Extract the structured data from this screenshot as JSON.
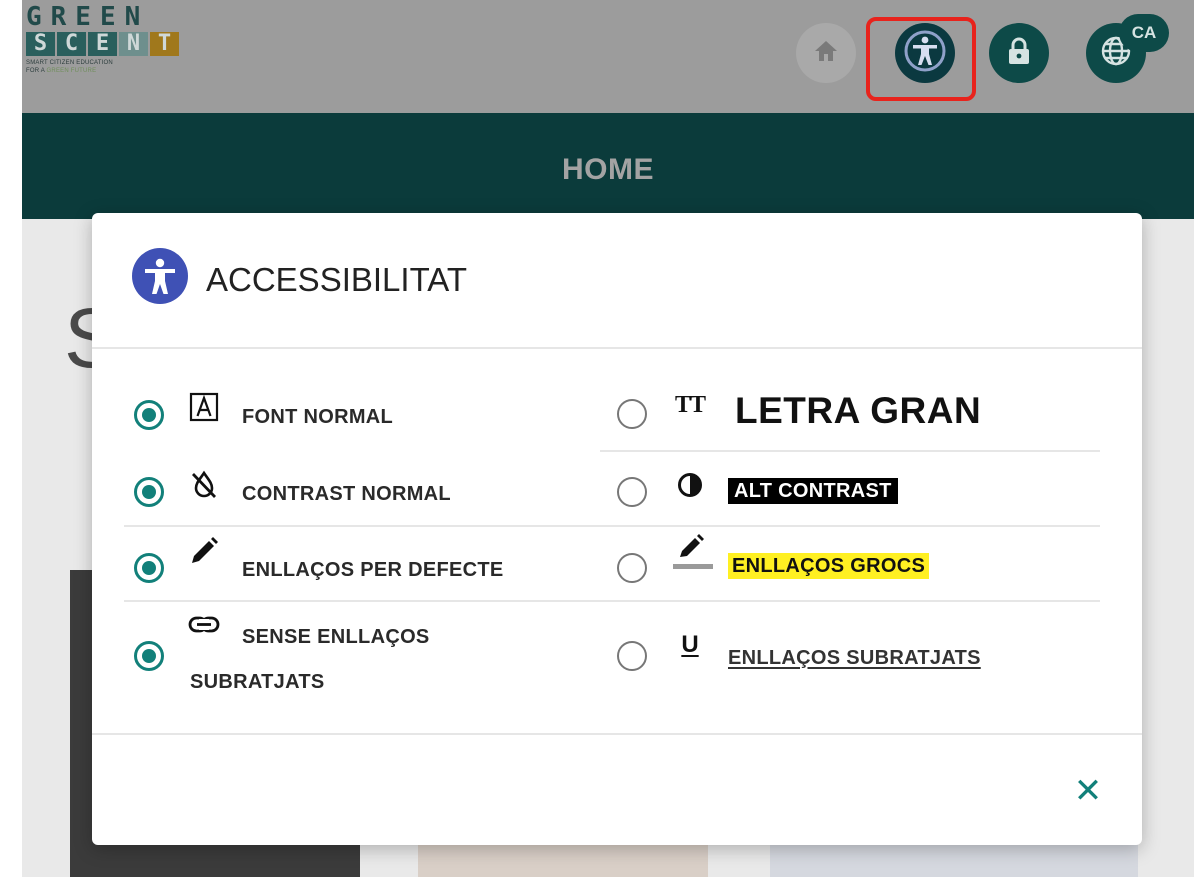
{
  "logo": {
    "line1": "GREEN",
    "line2": [
      "S",
      "C",
      "E",
      "N",
      "T"
    ],
    "tagline1": "SMART CITIZEN EDUCATION",
    "tagline2_prefix": "FOR A ",
    "tagline2_highlight": "GREEN FUTURE"
  },
  "header": {
    "language_badge": "CA",
    "icons": [
      "home-icon",
      "accessibility-icon",
      "lock-icon",
      "globe-icon"
    ]
  },
  "nav": {
    "home_label": "HOME"
  },
  "background": {
    "letter": "S"
  },
  "modal": {
    "title": "ACCESSIBILITAT",
    "left_options": [
      {
        "label": "FONT NORMAL",
        "checked": true,
        "icon": "font-a-icon"
      },
      {
        "label": "CONTRAST NORMAL",
        "checked": true,
        "icon": "invert-off-icon"
      },
      {
        "label": "ENLLAÇOS PER DEFECTE",
        "checked": true,
        "icon": "pencil-icon"
      },
      {
        "label_line1": "SENSE ENLLAÇOS",
        "label_line2": "SUBRATJATS",
        "checked": true,
        "icon": "link-icon"
      }
    ],
    "right_options": [
      {
        "label": "LETRA GRAN",
        "checked": false,
        "icon": "text-size-icon",
        "icon_text": "TT"
      },
      {
        "label": "ALT CONTRAST",
        "checked": false,
        "icon": "contrast-icon"
      },
      {
        "label": "ENLLAÇOS GROCS",
        "checked": false,
        "icon": "pencil-underline-icon"
      },
      {
        "label": "ENLLAÇOS SUBRATJATS",
        "checked": false,
        "icon": "underline-icon",
        "icon_text": "U"
      }
    ],
    "close_glyph": "✕"
  },
  "colors": {
    "teal": "#12807a",
    "navbar": "#0b3b3b",
    "accessibility_blue": "#3f51b5",
    "highlight_red": "#e8231c",
    "yellow": "#fff022"
  }
}
